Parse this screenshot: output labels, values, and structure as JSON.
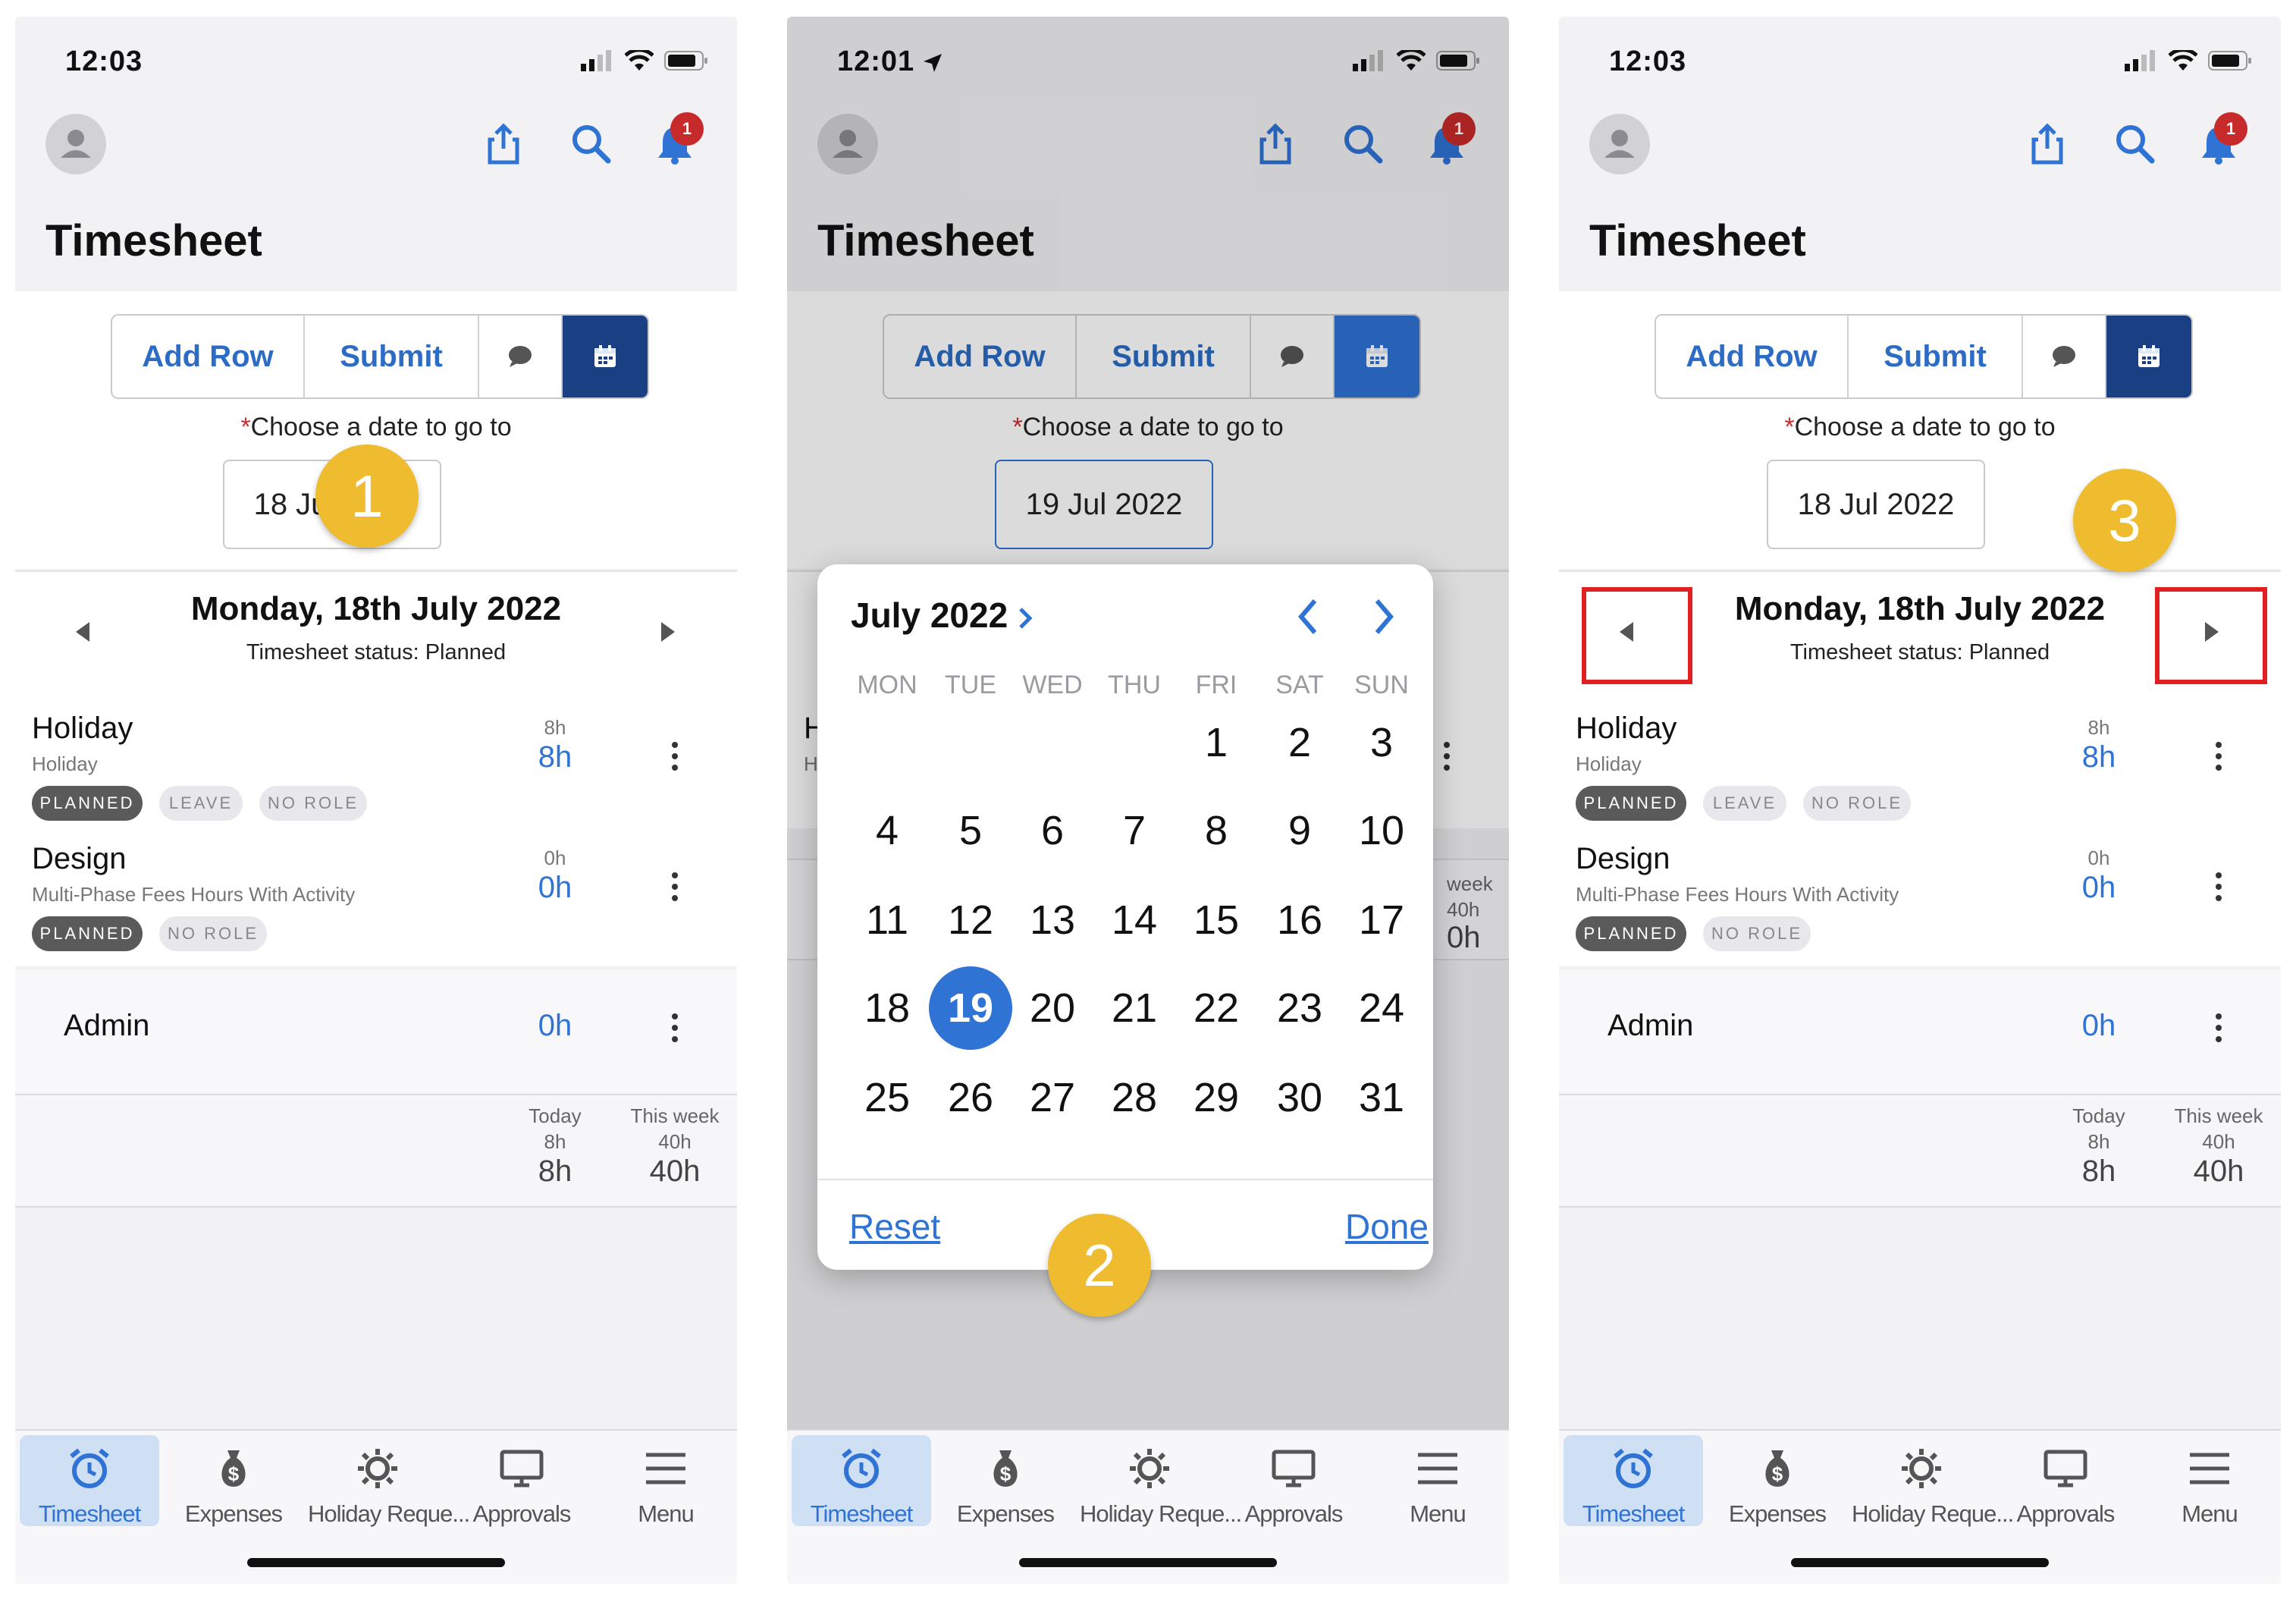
{
  "screens": [
    {
      "status_time": "12:03",
      "title": "Timesheet",
      "toolbar": {
        "add_row": "Add Row",
        "submit": "Submit"
      },
      "choose_label": "Choose a date to go to",
      "date_value": "18 Jul 2022",
      "day_title": "Monday, 18th July 2022",
      "day_status": "Timesheet status: Planned",
      "notification_count": "1",
      "step_badge": "1"
    },
    {
      "status_time": "12:01",
      "title": "Timesheet",
      "toolbar": {
        "add_row": "Add Row",
        "submit": "Submit"
      },
      "choose_label": "Choose a date to go to",
      "date_value": "19 Jul 2022",
      "notification_count": "1",
      "step_badge": "2",
      "calendar": {
        "month_label": "July 2022",
        "weekdays": [
          "MON",
          "TUE",
          "WED",
          "THU",
          "FRI",
          "SAT",
          "SUN"
        ],
        "days": [
          "1",
          "2",
          "3",
          "4",
          "5",
          "6",
          "7",
          "8",
          "9",
          "10",
          "11",
          "12",
          "13",
          "14",
          "15",
          "16",
          "17",
          "18",
          "19",
          "20",
          "21",
          "22",
          "23",
          "24",
          "25",
          "26",
          "27",
          "28",
          "29",
          "30",
          "31"
        ],
        "selected_day": "19",
        "reset": "Reset",
        "done": "Done"
      },
      "peek": {
        "h": "H",
        "h2": "H",
        "week": "week",
        "week_val": "40h",
        "week_big": "0h"
      }
    },
    {
      "status_time": "12:03",
      "title": "Timesheet",
      "toolbar": {
        "add_row": "Add Row",
        "submit": "Submit"
      },
      "choose_label": "Choose a date to go to",
      "date_value": "18 Jul 2022",
      "day_title": "Monday, 18th July 2022",
      "day_status": "Timesheet status: Planned",
      "notification_count": "1",
      "step_badge": "3"
    }
  ],
  "entries": [
    {
      "name": "Holiday",
      "sub": "Holiday",
      "chips": [
        "PLANNED",
        "LEAVE",
        "NO ROLE"
      ],
      "small": "8h",
      "big": "8h"
    },
    {
      "name": "Design",
      "sub": "Multi-Phase Fees Hours With Activity",
      "chips": [
        "PLANNED",
        "NO ROLE"
      ],
      "small": "0h",
      "big": "0h"
    },
    {
      "name": "Admin",
      "big": "0h"
    }
  ],
  "totals": {
    "today_label": "Today",
    "today_small": "8h",
    "today_big": "8h",
    "week_label": "This week",
    "week_small": "40h",
    "week_big": "40h"
  },
  "nav": [
    "Timesheet",
    "Expenses",
    "Holiday Reque...",
    "Approvals",
    "Menu"
  ],
  "colors": {
    "accent": "#2f73d5",
    "dark_accent": "#1b3f83",
    "badge": "#eebc2e",
    "highlight": "#e02020",
    "bell_badge": "#c72a2a"
  },
  "icons": [
    "share-icon",
    "search-icon",
    "bell-icon",
    "chat-icon",
    "calendar-icon",
    "alarm-clock-icon",
    "money-bag-icon",
    "sun-gear-icon",
    "monitor-icon",
    "hamburger-menu-icon"
  ]
}
